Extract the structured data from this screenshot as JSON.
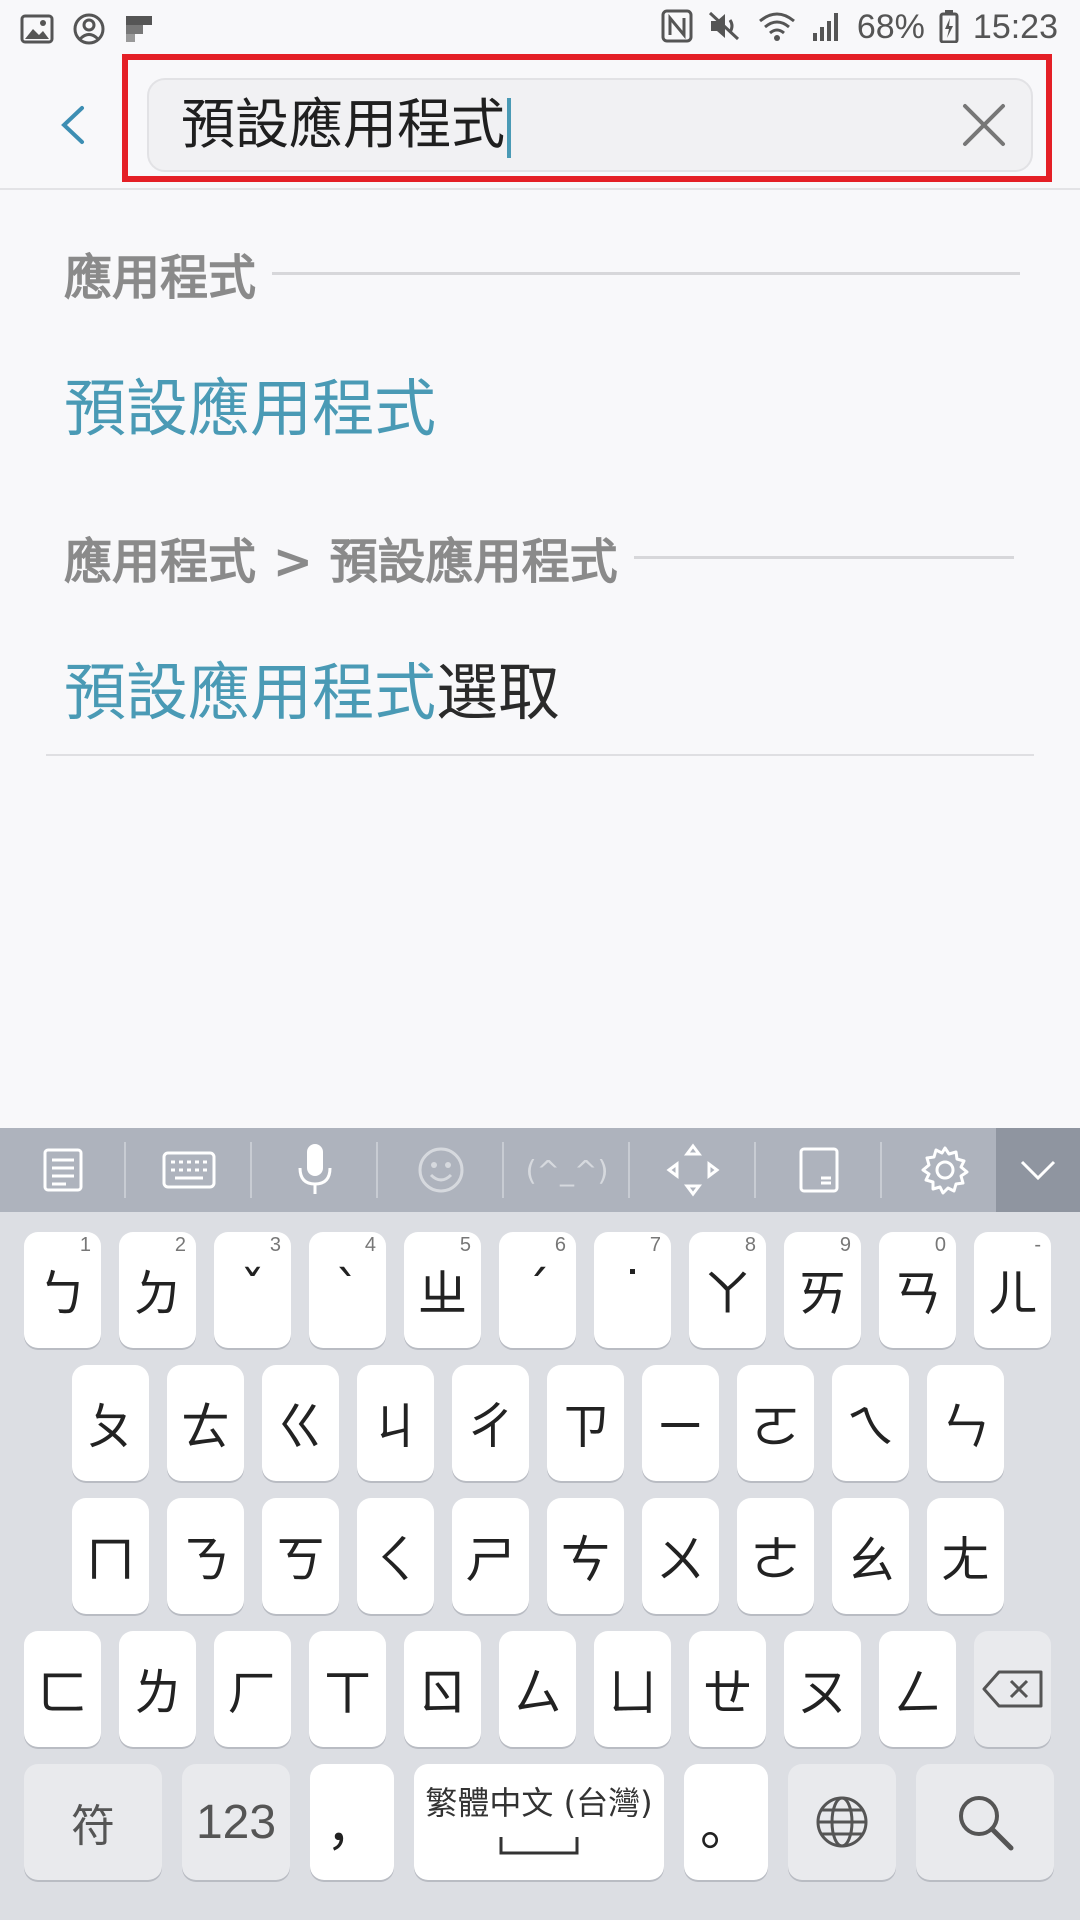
{
  "status_bar": {
    "battery": "68%",
    "time": "15:23"
  },
  "search": {
    "query": "預設應用程式"
  },
  "results": {
    "section1_title": "應用程式",
    "result1_label": "預設應用程式",
    "section2_title": "應用程式 > 預設應用程式",
    "result2_match": "預設應用程式",
    "result2_rest": "選取"
  },
  "keyboard": {
    "toolbar_items": [
      "clipboard-icon",
      "keyboard-icon",
      "microphone-icon",
      "emoji-icon",
      "emoticon",
      "cursor-move-icon",
      "one-hand-icon",
      "settings-icon"
    ],
    "emoticon_label": "(^_^)",
    "row1": [
      {
        "key": "ㄅ",
        "hint": "1"
      },
      {
        "key": "ㄉ",
        "hint": "2"
      },
      {
        "key": "ˇ",
        "hint": "3"
      },
      {
        "key": "ˋ",
        "hint": "4"
      },
      {
        "key": "ㄓ",
        "hint": "5"
      },
      {
        "key": "ˊ",
        "hint": "6"
      },
      {
        "key": "˙",
        "hint": "7"
      },
      {
        "key": "ㄚ",
        "hint": "8"
      },
      {
        "key": "ㄞ",
        "hint": "9"
      },
      {
        "key": "ㄢ",
        "hint": "0"
      },
      {
        "key": "ㄦ",
        "hint": "-"
      }
    ],
    "row2": [
      "ㄆ",
      "ㄊ",
      "ㄍ",
      "ㄐ",
      "ㄔ",
      "ㄗ",
      "ㄧ",
      "ㄛ",
      "ㄟ",
      "ㄣ"
    ],
    "row3": [
      "ㄇ",
      "ㄋ",
      "ㄎ",
      "ㄑ",
      "ㄕ",
      "ㄘ",
      "ㄨ",
      "ㄜ",
      "ㄠ",
      "ㄤ"
    ],
    "row4": [
      "ㄈ",
      "ㄌ",
      "ㄏ",
      "ㄒ",
      "ㄖ",
      "ㄙ",
      "ㄩ",
      "ㄝ",
      "ㄡ",
      "ㄥ"
    ],
    "symbols_label": "符",
    "numbers_label": "123",
    "comma_label": "，",
    "space_label": "繁體中文 (台灣)",
    "period_label": "。"
  }
}
